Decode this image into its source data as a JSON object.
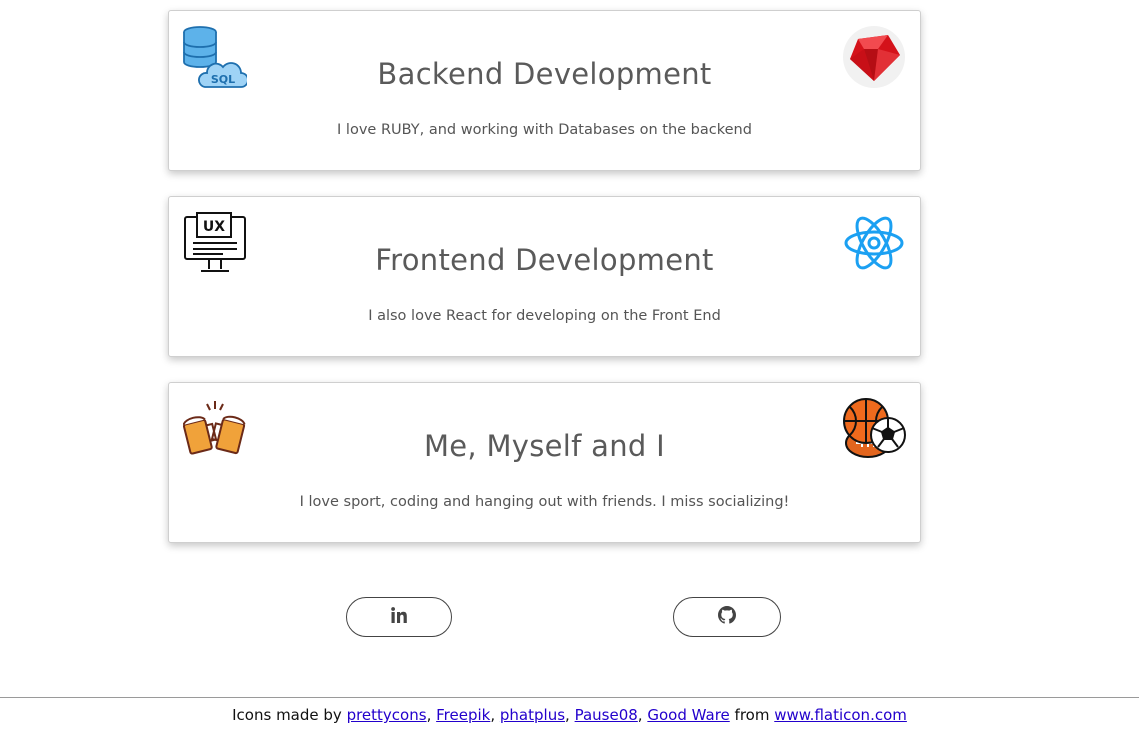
{
  "cards": [
    {
      "title": "Backend Development",
      "text": "I love RUBY, and working with Databases on the backend",
      "left_icon": "sql-database-icon",
      "right_icon": "ruby-icon"
    },
    {
      "title": "Frontend Development",
      "text": "I also love React for developing on the Front End",
      "left_icon": "ux-monitor-icon",
      "right_icon": "react-atom-icon"
    },
    {
      "title": "Me, Myself and I",
      "text": "I love sport, coding and hanging out with friends. I miss socializing!",
      "left_icon": "beer-cheers-icon",
      "right_icon": "sports-balls-icon"
    }
  ],
  "social": {
    "linkedin_icon": "linkedin-icon",
    "github_icon": "github-icon"
  },
  "footer": {
    "prefix": "Icons made by",
    "authors": [
      "prettycons",
      "Freepik",
      "phatplus",
      "Pause08",
      "Good Ware"
    ],
    "sep": ",",
    "from": "from",
    "site": "www.flaticon.com"
  },
  "colors": {
    "ruby": "#e0262b",
    "react": "#1ba0f2",
    "sql": "#2d8fd5",
    "beer": "#e7952a",
    "basketball": "#e8601c"
  }
}
